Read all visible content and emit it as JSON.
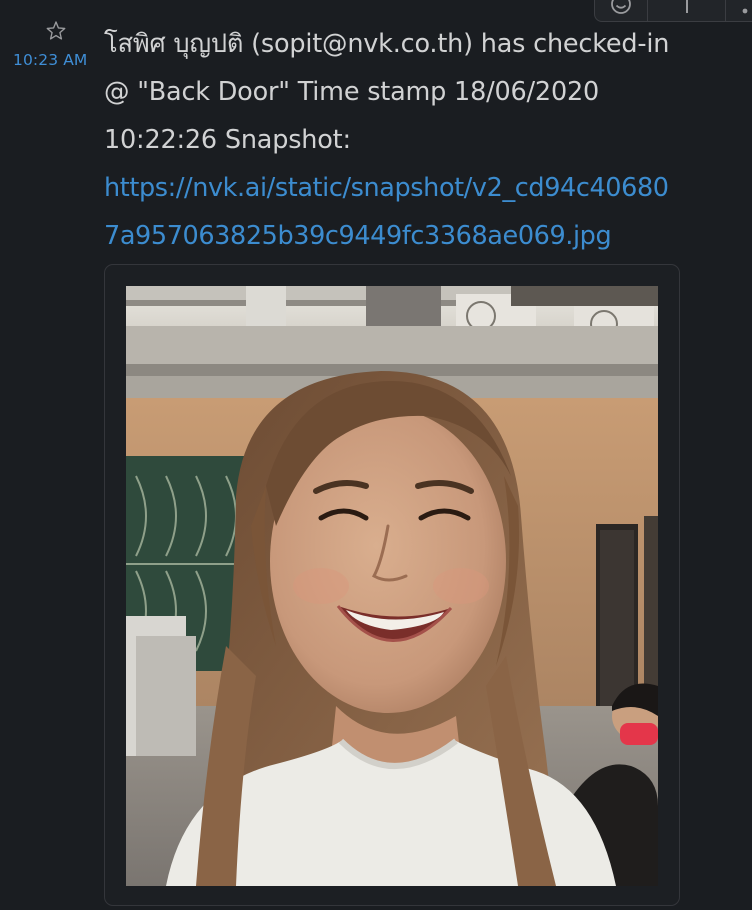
{
  "message": {
    "timestamp": "10:23 AM",
    "lines": [
      "โสพิศ  บุญปติ (sopit@nvk.co.th) has checked-in",
      "@ \"Back Door\" Time stamp 18/06/2020",
      "10:22:26 Snapshot:"
    ],
    "link_lines": [
      "https://nvk.ai/static/snapshot/v2_cd94c40680",
      "7a957063825b39c9449fc3368ae069.jpg"
    ]
  },
  "icons": {
    "star": "star-icon",
    "emoji": "emoji-icon",
    "thread": "thread-icon",
    "more": "more-icon"
  },
  "colors": {
    "background": "#1a1d21",
    "text": "#d1d2d3",
    "link": "#3c8ccf",
    "timestamp": "#3f8ed6"
  }
}
